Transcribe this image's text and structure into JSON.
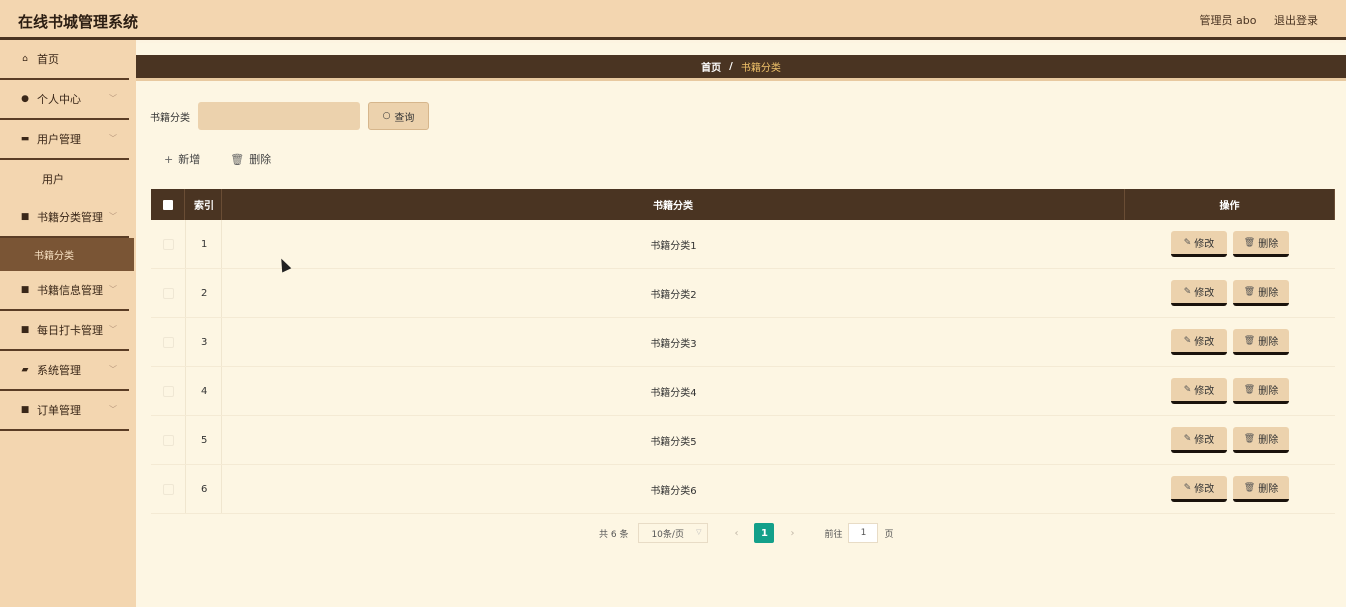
{
  "header": {
    "app_title": "在线书城管理系统",
    "user_label": "管理员 abo",
    "logout_label": "退出登录"
  },
  "sidebar": {
    "items": [
      {
        "label": "首页",
        "icon": "home-icon"
      },
      {
        "label": "个人中心",
        "icon": "user-icon"
      },
      {
        "label": "用户管理",
        "icon": "users-icon"
      },
      {
        "label": "用户",
        "icon": ""
      },
      {
        "label": "书籍分类管理",
        "icon": "grid-icon"
      },
      {
        "label": "书籍分类",
        "icon": ""
      },
      {
        "label": "书籍信息管理",
        "icon": "grid-icon"
      },
      {
        "label": "每日打卡管理",
        "icon": "grid-icon"
      },
      {
        "label": "系统管理",
        "icon": "book-icon"
      },
      {
        "label": "订单管理",
        "icon": "grid-icon"
      }
    ]
  },
  "breadcrumb": {
    "home": "首页",
    "separator": "/",
    "current": "书籍分类"
  },
  "search": {
    "label": "书籍分类",
    "placeholder": "",
    "button_label": "查询"
  },
  "actions": {
    "add_label": "新增",
    "delete_label": "删除"
  },
  "table": {
    "headers": {
      "index": "索引",
      "category": "书籍分类",
      "operation": "操作"
    },
    "rows": [
      {
        "index": "1",
        "category": "书籍分类1"
      },
      {
        "index": "2",
        "category": "书籍分类2"
      },
      {
        "index": "3",
        "category": "书籍分类3"
      },
      {
        "index": "4",
        "category": "书籍分类4"
      },
      {
        "index": "5",
        "category": "书籍分类5"
      },
      {
        "index": "6",
        "category": "书籍分类6"
      }
    ],
    "edit_label": "修改",
    "delete_label": "删除"
  },
  "pagination": {
    "total": "共 6 条",
    "page_size": "10条/页",
    "current_page": "1",
    "goto_label": "前往",
    "goto_value": "1",
    "page_unit": "页"
  },
  "colors": {
    "header_bg": "#f3d6b0",
    "dark_brown": "#4a3422",
    "active_page": "#13a08a",
    "button_bg": "#ecd2ad"
  }
}
